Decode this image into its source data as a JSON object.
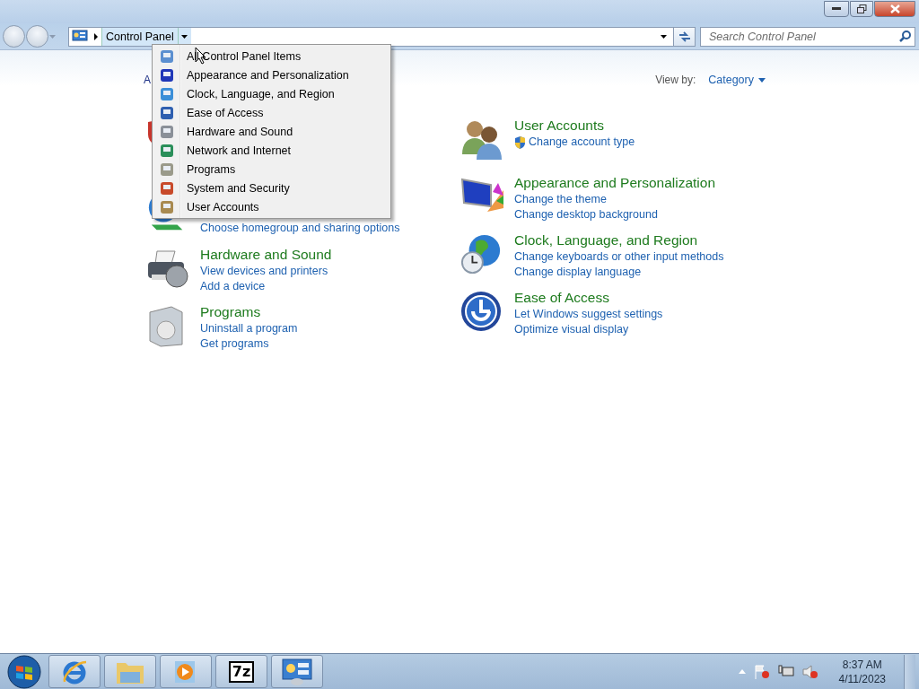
{
  "address_bar": {
    "breadcrumb": "Control Panel",
    "search_placeholder": "Search Control Panel"
  },
  "breadcrumb_menu": {
    "items": [
      {
        "label": "All Control Panel Items"
      },
      {
        "label": "Appearance and Personalization"
      },
      {
        "label": "Clock, Language, and Region"
      },
      {
        "label": "Ease of Access"
      },
      {
        "label": "Hardware and Sound"
      },
      {
        "label": "Network and Internet"
      },
      {
        "label": "Programs"
      },
      {
        "label": "System and Security"
      },
      {
        "label": "User Accounts"
      }
    ]
  },
  "heading_fragment": "A",
  "view_by": {
    "label": "View by:",
    "value": "Category"
  },
  "left_categories": [
    {
      "kind": "covered"
    },
    {
      "kind": "partly-covered",
      "links": [
        {
          "text": "Choose homegroup and sharing options",
          "kind": "plain"
        }
      ]
    },
    {
      "kind": "full",
      "title": "Hardware and Sound",
      "links": [
        {
          "text": "View devices and printers",
          "kind": "plain"
        },
        {
          "text": "Add a device",
          "kind": "plain"
        }
      ]
    },
    {
      "kind": "full",
      "title": "Programs",
      "links": [
        {
          "text": "Uninstall a program",
          "kind": "plain"
        },
        {
          "text": "Get programs",
          "kind": "plain"
        }
      ]
    }
  ],
  "right_categories": [
    {
      "kind": "full",
      "title": "User Accounts",
      "links": [
        {
          "text": "Change account type",
          "kind": "admin"
        }
      ]
    },
    {
      "kind": "full",
      "title": "Appearance and Personalization",
      "links": [
        {
          "text": "Change the theme",
          "kind": "plain"
        },
        {
          "text": "Change desktop background",
          "kind": "plain"
        }
      ]
    },
    {
      "kind": "full",
      "title": "Clock, Language, and Region",
      "links": [
        {
          "text": "Change keyboards or other input methods",
          "kind": "plain"
        },
        {
          "text": "Change display language",
          "kind": "plain"
        }
      ]
    },
    {
      "kind": "full",
      "title": "Ease of Access",
      "links": [
        {
          "text": "Let Windows suggest settings",
          "kind": "plain"
        },
        {
          "text": "Optimize visual display",
          "kind": "plain"
        }
      ]
    }
  ],
  "taskbar": {
    "apps": [
      {
        "kind": "browser"
      },
      {
        "kind": "folder"
      },
      {
        "kind": "player"
      },
      {
        "kind": "archiver",
        "label": "7z"
      },
      {
        "kind": "control-panel"
      }
    ],
    "time": "8:37 AM",
    "date": "4/11/2023"
  }
}
